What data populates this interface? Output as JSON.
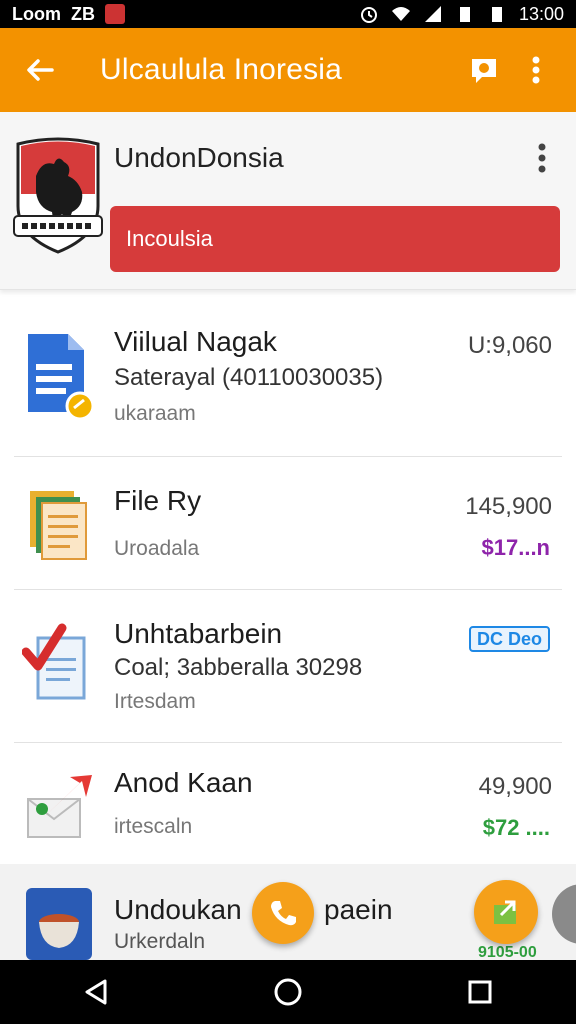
{
  "status_bar": {
    "carrier": "Loom",
    "extra": "ZB",
    "time": "13:00",
    "icons": [
      "flag-icon",
      "alarm-icon",
      "wifi-icon",
      "signal-icon",
      "battery-icon",
      "battery-icon"
    ]
  },
  "app_bar": {
    "title": "Ulcaulula Inoresia",
    "back_icon": "arrow-left-icon",
    "action_icon": "chat-icon",
    "more_icon": "more-vertical-icon"
  },
  "header": {
    "name": "UndonDonsia",
    "button_label": "Incoulsia",
    "button_color": "#d63b3b"
  },
  "list": {
    "items": [
      {
        "title": "Viilual Nagak",
        "subtitle": "Saterayal (40110030035)",
        "meta": "ukaraam",
        "value": "U:9,060",
        "price": "",
        "icon": "document-icon"
      },
      {
        "title": "File Ry",
        "subtitle": "",
        "meta": "Uroadala",
        "value": "145,900",
        "price": "$17...n",
        "price_color": "#8e24aa",
        "icon": "files-icon"
      },
      {
        "title": "Unhtabarbein",
        "subtitle": "Coal; 3abberalla 30298",
        "meta": "Irtesdam",
        "value": "",
        "badge": "DC Deo",
        "icon": "checklist-icon"
      },
      {
        "title": "Anod Kaan",
        "subtitle": "",
        "meta": "irtescaln",
        "value": "49,900",
        "price": "$72 ....",
        "price_color": "#2e9e3e",
        "icon": "mail-arrow-icon"
      },
      {
        "title": "Undoukan",
        "title_tail": "paein",
        "subtitle": "",
        "meta": "Urkerdaln",
        "value": "",
        "price": "9105-00",
        "price_color": "#2e9e3e",
        "icon": "tea-cup-icon"
      }
    ]
  },
  "fabs": {
    "call_icon": "phone-icon",
    "share_icon": "export-icon"
  },
  "nav_bar": {
    "icons": [
      "back-triangle-icon",
      "home-circle-icon",
      "recents-square-icon"
    ]
  },
  "colors": {
    "accent": "#f39200",
    "fab": "#f5a01a"
  }
}
